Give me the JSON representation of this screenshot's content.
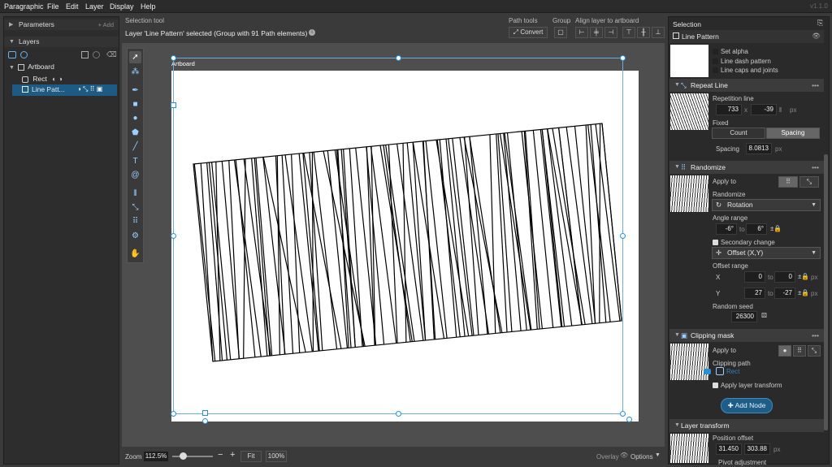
{
  "menu": {
    "app": "Paragraphic",
    "items": [
      "File",
      "Edit",
      "Layer",
      "Display",
      "Help"
    ],
    "version": "v1.1.0"
  },
  "left": {
    "parameters": "Parameters",
    "add": "+ Add",
    "layers": "Layers",
    "tree": {
      "artboard": "Artboard",
      "rect": "Rect",
      "line": "Line Patt..."
    }
  },
  "top": {
    "selection_tool": "Selection tool",
    "status": "Layer 'Line Pattern' selected (Group with 91 Path elements)",
    "path_tools": "Path tools",
    "convert": "Convert",
    "group": "Group",
    "align": "Align layer to artboard"
  },
  "canvas": {
    "artboard_label": "Artboard"
  },
  "bottom": {
    "zoom_label": "Zoom",
    "zoom": "112.5%",
    "fit": "Fit",
    "hundred": "100%",
    "overlay": "Overlay",
    "options": "Options"
  },
  "right": {
    "title": "Selection",
    "layer_name": "Line Pattern",
    "set_alpha": "Set alpha",
    "line_dash": "Line dash pattern",
    "line_caps": "Line caps and joints",
    "repeat": {
      "title": "Repeat Line",
      "rep_line": "Repetition line",
      "x": "733",
      "y": "-39",
      "unit": "px",
      "fixed": "Fixed",
      "count": "Count",
      "spacing_btn": "Spacing",
      "spacing_lbl": "Spacing",
      "spacing": "8.0813",
      "spacing_unit": "px"
    },
    "randomize": {
      "title": "Randomize",
      "apply_to": "Apply to",
      "randomize": "Randomize",
      "rotation": "Rotation",
      "angle_range": "Angle range",
      "a_from": "-6°",
      "to": "to",
      "a_to": "6°",
      "secondary": "Secondary change",
      "offset": "Offset (X,Y)",
      "offset_range": "Offset range",
      "x": "X",
      "x_from": "0",
      "x_to": "0",
      "y": "Y",
      "y_from": "27",
      "y_to": "-27",
      "px": "px",
      "seed_lbl": "Random seed",
      "seed": "26300"
    },
    "clip": {
      "title": "Clipping mask",
      "apply_to": "Apply to",
      "clip_path": "Clipping path",
      "rect": "Rect",
      "apply_transform": "Apply layer transform"
    },
    "add_node": "Add Node",
    "transform": {
      "title": "Layer transform",
      "pos": "Position offset",
      "x": "31.450",
      "y": "303.88",
      "unit": "px",
      "pivot": "Pivot adjustment"
    }
  }
}
